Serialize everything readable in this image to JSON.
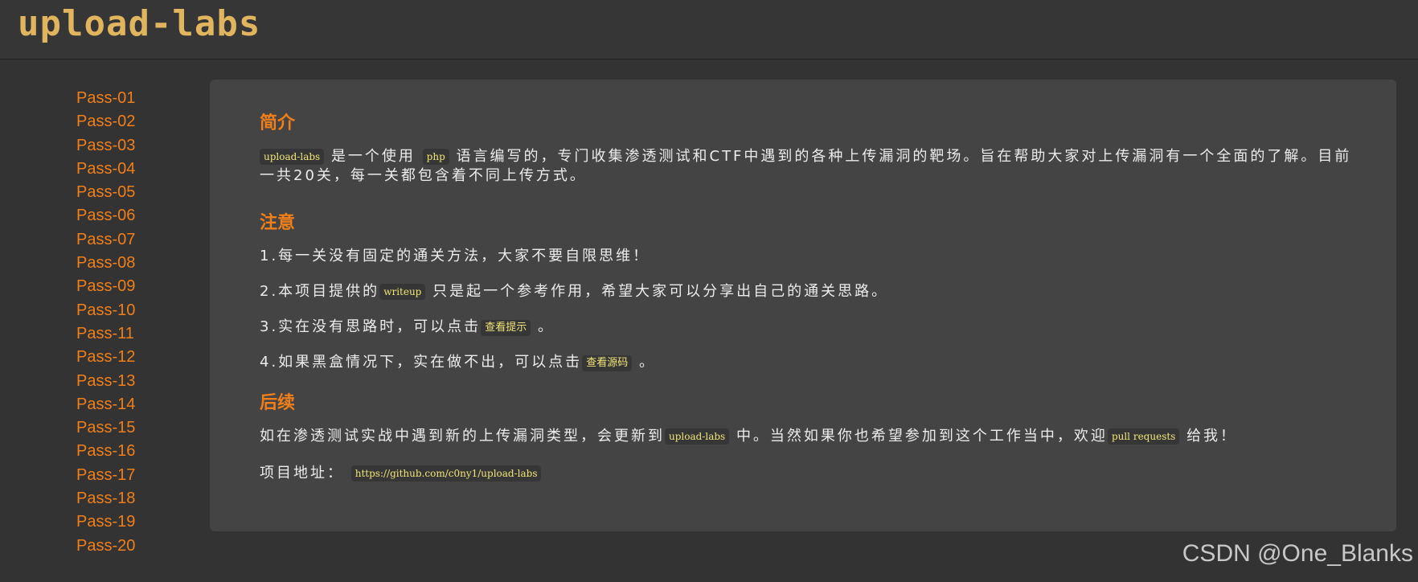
{
  "header": {
    "logo_text": "upload-labs"
  },
  "sidebar": {
    "items": [
      "Pass-01",
      "Pass-02",
      "Pass-03",
      "Pass-04",
      "Pass-05",
      "Pass-06",
      "Pass-07",
      "Pass-08",
      "Pass-09",
      "Pass-10",
      "Pass-11",
      "Pass-12",
      "Pass-13",
      "Pass-14",
      "Pass-15",
      "Pass-16",
      "Pass-17",
      "Pass-18",
      "Pass-19",
      "Pass-20"
    ]
  },
  "intro": {
    "heading": "简介",
    "code_upload_labs": "upload-labs",
    "text_a": "是一个使用",
    "code_php": "php",
    "text_b": "语言编写的，专门收集渗透测试和CTF中遇到的各种上传漏洞的靶场。旨在帮助大家对上传漏洞有一个全面的了解。目前一共20关，每一关都包含着不同上传方式。"
  },
  "notice": {
    "heading": "注意",
    "item1": "1.每一关没有固定的通关方法，大家不要自限思维！",
    "item2_a": "2.本项目提供的",
    "item2_code": "writeup",
    "item2_b": "只是起一个参考作用，希望大家可以分享出自己的通关思路。",
    "item3_a": "3.实在没有思路时，可以点击",
    "item3_button": "查看提示",
    "item3_b": "。",
    "item4_a": "4.如果黑盒情况下，实在做不出，可以点击",
    "item4_button": "查看源码",
    "item4_b": "。"
  },
  "followup": {
    "heading": "后续",
    "text_a": "如在渗透测试实战中遇到新的上传漏洞类型，会更新到",
    "code_upload_labs": "upload-labs",
    "text_b": "中。当然如果你也希望参加到这个工作当中，欢迎",
    "code_pull": "pull requests",
    "text_c": "给我！",
    "address_label": "项目地址：",
    "address_link": "https://github.com/c0ny1/upload-labs"
  },
  "watermark": "CSDN @One_Blanks"
}
